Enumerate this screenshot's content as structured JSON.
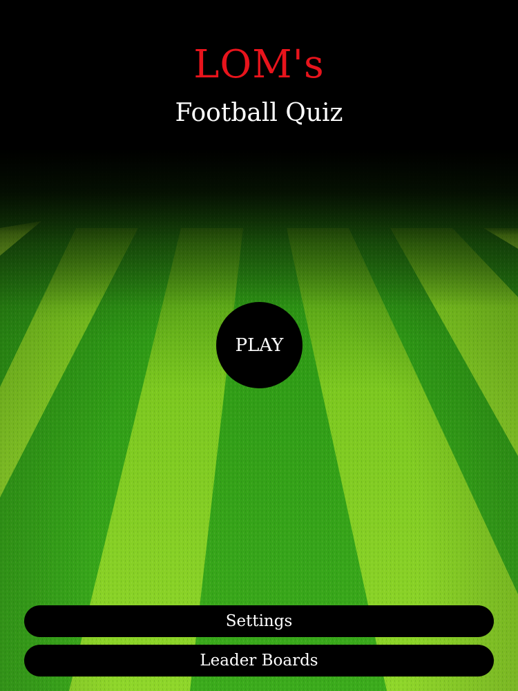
{
  "header": {
    "title": "LOM's",
    "subtitle": "Football Quiz"
  },
  "main": {
    "play_label": "PLAY"
  },
  "menu": {
    "settings_label": "Settings",
    "leaderboards_label": "Leader Boards"
  },
  "colors": {
    "title_red": "#e8141c",
    "grass_light": "#7ed321",
    "grass_dark": "#2f9e14",
    "button_bg": "#000000"
  },
  "icons": {
    "background": "football-pitch-image"
  }
}
